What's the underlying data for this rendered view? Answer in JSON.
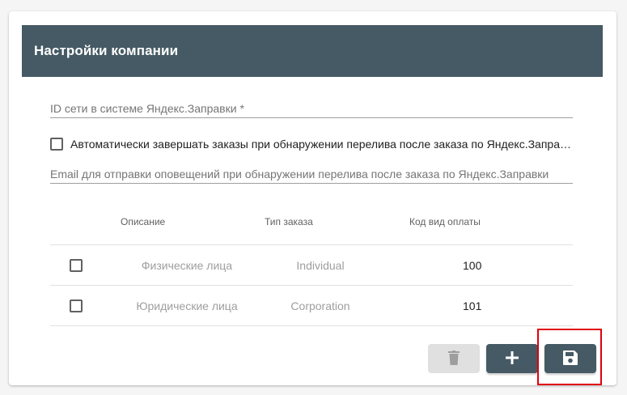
{
  "header": {
    "title": "Настройки компании"
  },
  "form": {
    "network_id_placeholder": "ID сети в системе Яндекс.Заправки *",
    "auto_complete_label": "Автоматически завершать заказы при обнаружении перелива после заказа по Яндекс.Заправки",
    "auto_complete_checked": false,
    "email_placeholder": "Email для отправки оповещений при обнаружении перелива после заказа по Яндекс.Заправки"
  },
  "table": {
    "columns": [
      "Описание",
      "Тип заказа",
      "Код вид оплаты"
    ],
    "rows": [
      {
        "description": "Физические лица",
        "order_type": "Individual",
        "payment_code": "100",
        "checked": false
      },
      {
        "description": "Юридические лица",
        "order_type": "Corporation",
        "payment_code": "101",
        "checked": false
      }
    ]
  },
  "actions": {
    "delete_icon": "trash-icon",
    "add_icon": "plus-icon",
    "save_icon": "floppy-disk-icon"
  },
  "colors": {
    "header_bg": "#455a64",
    "button_bg": "#455a64",
    "button_disabled_bg": "#e0e0e0",
    "highlight_border": "#e0000c"
  }
}
